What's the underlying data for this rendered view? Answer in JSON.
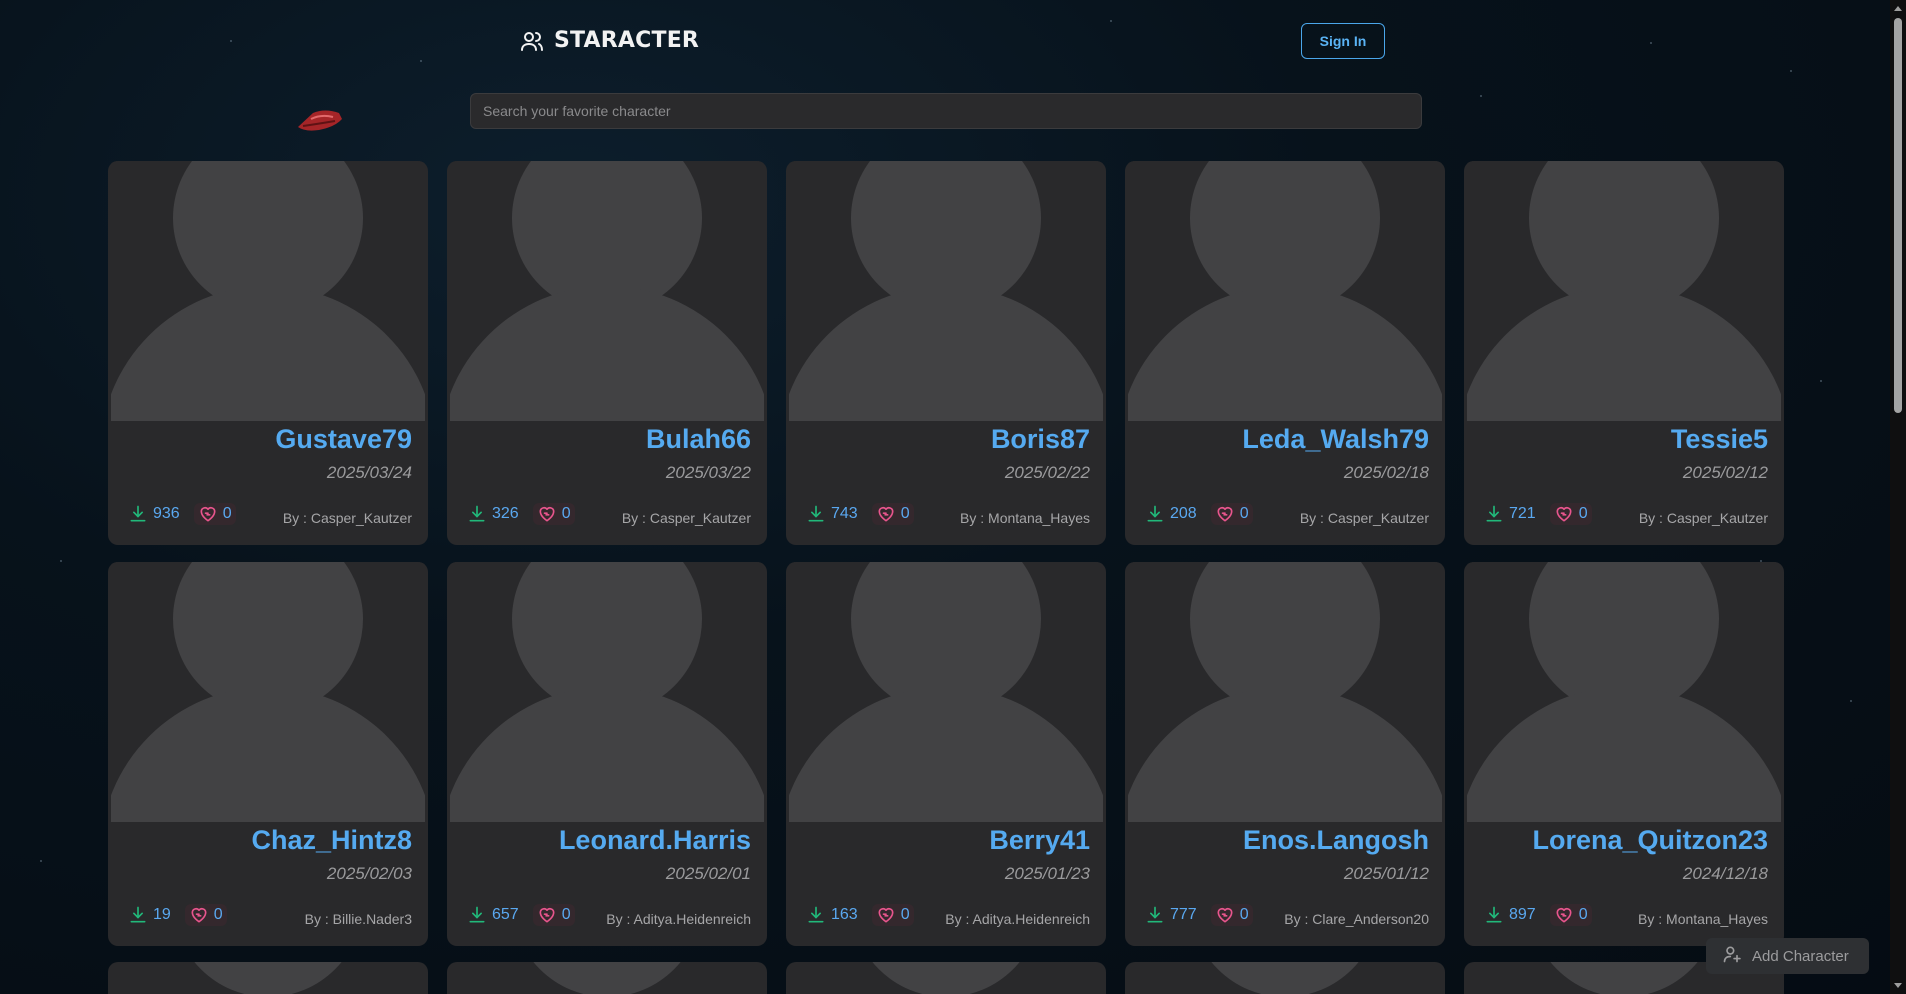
{
  "app": {
    "title": "STARACTER",
    "signin_label": "Sign In",
    "search_placeholder": "Search your favorite character",
    "add_character_label": "Add Character"
  },
  "colors": {
    "accent": "#55aaf0",
    "card_bg": "#29292b",
    "download_icon": "#21b87a",
    "like_icon": "#e8558d"
  },
  "characters": [
    {
      "name": "Gustave79",
      "date": "2025/03/24",
      "downloads": "936",
      "likes": "0",
      "author": "By : Casper_Kautzer"
    },
    {
      "name": "Bulah66",
      "date": "2025/03/22",
      "downloads": "326",
      "likes": "0",
      "author": "By : Casper_Kautzer"
    },
    {
      "name": "Boris87",
      "date": "2025/02/22",
      "downloads": "743",
      "likes": "0",
      "author": "By : Montana_Hayes"
    },
    {
      "name": "Leda_Walsh79",
      "date": "2025/02/18",
      "downloads": "208",
      "likes": "0",
      "author": "By : Casper_Kautzer"
    },
    {
      "name": "Tessie5",
      "date": "2025/02/12",
      "downloads": "721",
      "likes": "0",
      "author": "By : Casper_Kautzer"
    },
    {
      "name": "Chaz_Hintz8",
      "date": "2025/02/03",
      "downloads": "19",
      "likes": "0",
      "author": "By : Billie.Nader3"
    },
    {
      "name": "Leonard.Harris",
      "date": "2025/02/01",
      "downloads": "657",
      "likes": "0",
      "author": "By : Aditya.Heidenreich"
    },
    {
      "name": "Berry41",
      "date": "2025/01/23",
      "downloads": "163",
      "likes": "0",
      "author": "By : Aditya.Heidenreich"
    },
    {
      "name": "Enos.Langosh",
      "date": "2025/01/12",
      "downloads": "777",
      "likes": "0",
      "author": "By : Clare_Anderson20"
    },
    {
      "name": "Lorena_Quitzon23",
      "date": "2024/12/18",
      "downloads": "897",
      "likes": "0",
      "author": "By : Montana_Hayes"
    }
  ]
}
